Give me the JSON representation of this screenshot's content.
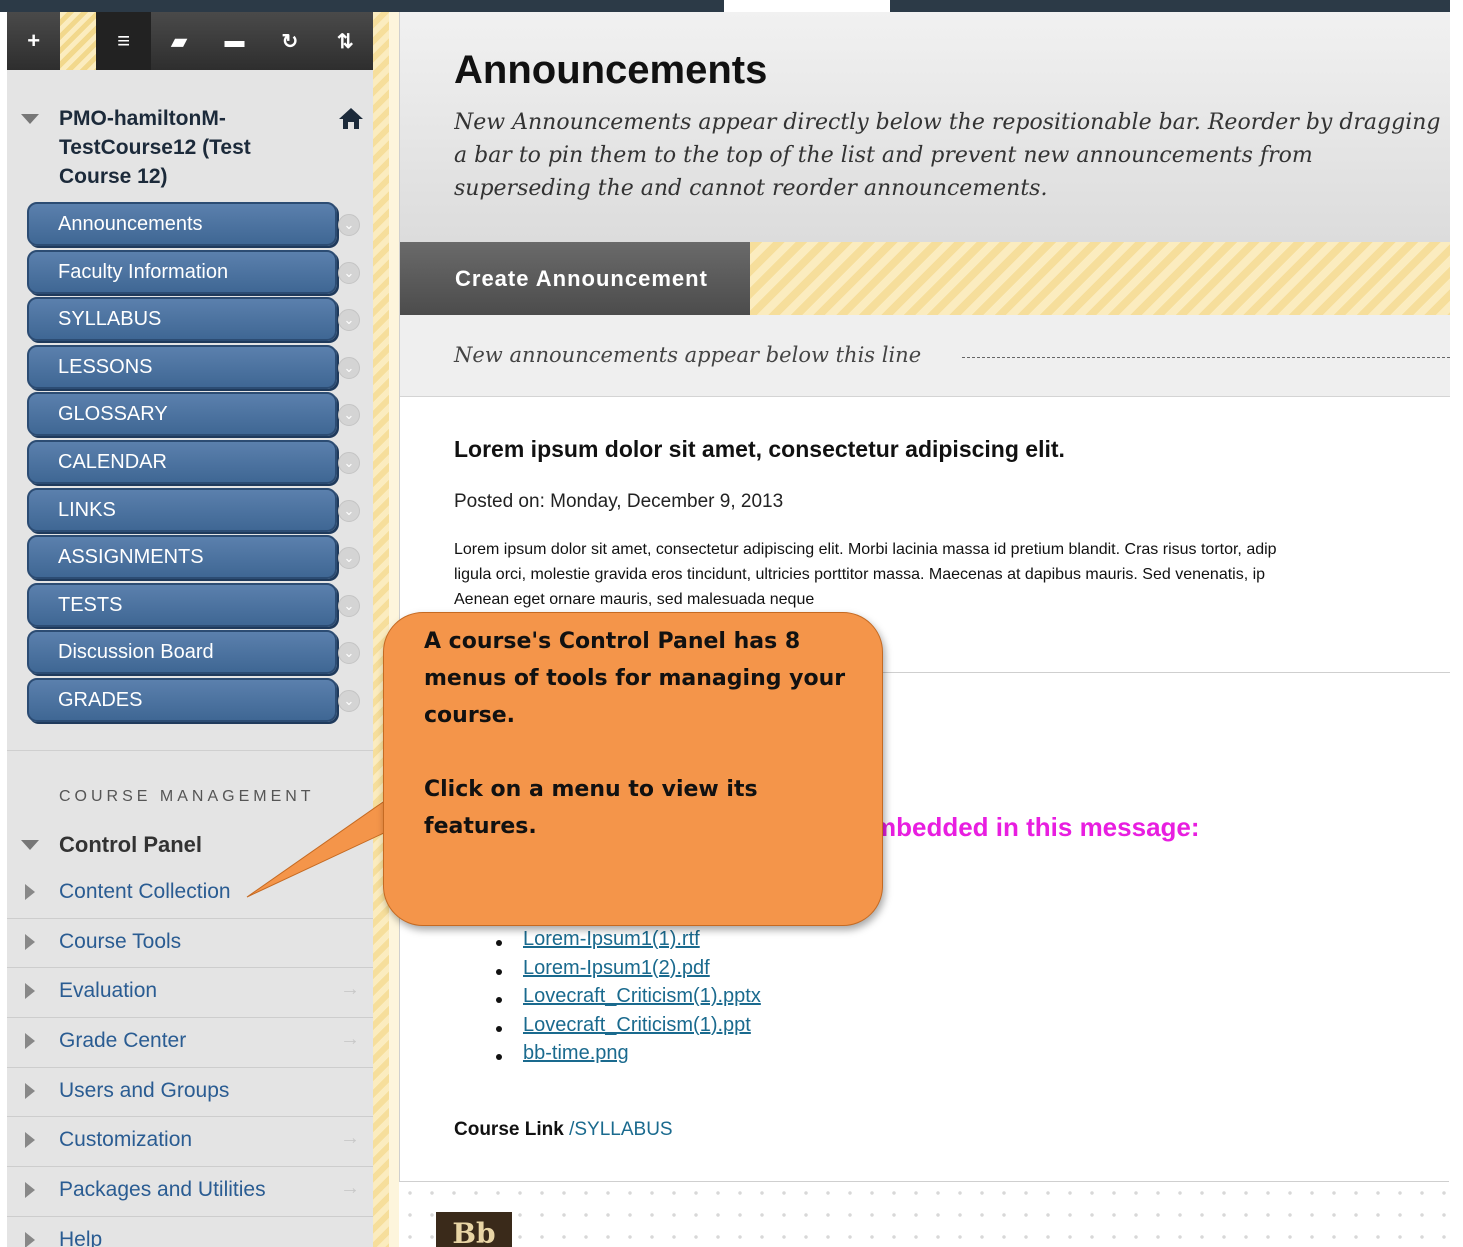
{
  "sidebar": {
    "toolbar": {
      "add": "+",
      "list": "≡",
      "folder": "▰",
      "window": "▬",
      "refresh": "↻",
      "sort": "⇅"
    },
    "course_title": "PMO-hamiltonM-TestCourse12 (Test Course 12)",
    "menu": [
      "Announcements",
      "Faculty Information",
      "SYLLABUS",
      "LESSONS",
      "GLOSSARY",
      "CALENDAR",
      "LINKS",
      "ASSIGNMENTS",
      "TESTS",
      "Discussion Board",
      "GRADES"
    ],
    "course_management_label": "COURSE MANAGEMENT",
    "control_panel_label": "Control Panel",
    "control_panel_items": [
      {
        "label": "Content Collection",
        "arrow": ""
      },
      {
        "label": "Course Tools",
        "arrow": ""
      },
      {
        "label": "Evaluation",
        "arrow": "→"
      },
      {
        "label": "Grade Center",
        "arrow": "→"
      },
      {
        "label": "Users and Groups",
        "arrow": ""
      },
      {
        "label": "Customization",
        "arrow": "→"
      },
      {
        "label": "Packages and Utilities",
        "arrow": "→"
      },
      {
        "label": "Help",
        "arrow": ""
      }
    ]
  },
  "main": {
    "title": "Announcements",
    "description": "New Announcements appear directly below the repositionable bar. Reorder by dragging a bar to pin them to the top of the list and prevent new announcements from superseding the and cannot reorder announcements.",
    "create_button": "Create Announcement",
    "pin_text": "New announcements appear below this line",
    "announcement": {
      "title": "Lorem ipsum dolor sit amet, consectetur adipiscing elit.",
      "posted": "Posted on: Monday, December 9, 2013",
      "body_line1": "Lorem ipsum dolor sit amet, consectetur adipiscing elit. Morbi lacinia massa id pretium blandit. Cras risus tortor, adip",
      "body_line2": "ligula orci, molestie gravida eros tincidunt, ultricies porttitor massa. Maecenas at dapibus mauris. Sed venenatis, ip",
      "body_line3": "Aenean eget ornare mauris, sed malesuada neque",
      "embedded_heading": "mbedded in this message:",
      "files": [
        "Lorem-Ipsum1(1).rtf",
        "Lorem-Ipsum1(2).pdf",
        "Lovecraft_Criticism(1).pptx",
        "Lovecraft_Criticism(1).ppt",
        "bb-time.png"
      ],
      "course_link_label": "Course Link",
      "course_link_value": "/SYLLABUS"
    }
  },
  "callout": {
    "text": "A course's Control Panel has 8 menus of tools for managing your course.\n\nClick on a menu to view its features."
  },
  "footer": {
    "logo": "Bb"
  },
  "colors": {
    "menu_blue": "#4a72a0",
    "link_blue": "#2a5c92",
    "callout_orange": "#f4954a",
    "embedded_magenta": "#e81ee0"
  }
}
